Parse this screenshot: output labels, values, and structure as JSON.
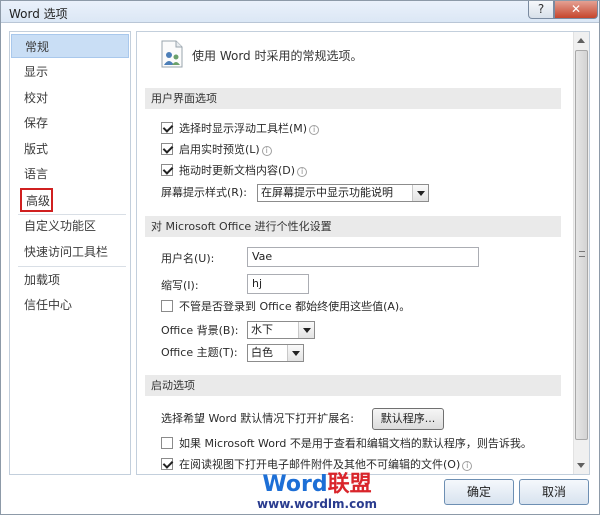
{
  "window": {
    "title": "Word 选项",
    "help_label": "?",
    "close_label": "✕"
  },
  "sidebar": {
    "items": [
      {
        "label": "常规"
      },
      {
        "label": "显示"
      },
      {
        "label": "校对"
      },
      {
        "label": "保存"
      },
      {
        "label": "版式"
      },
      {
        "label": "语言"
      },
      {
        "label": "高级"
      },
      {
        "label": "自定义功能区"
      },
      {
        "label": "快速访问工具栏"
      },
      {
        "label": "加载项"
      },
      {
        "label": "信任中心"
      }
    ],
    "selected": "常规",
    "highlighted": "高级",
    "highlight_color": "#d02020"
  },
  "main": {
    "header_text": "使用 Word 时采用的常规选项。",
    "sections": {
      "ui": {
        "title": "用户界面选项",
        "opt1": "选择时显示浮动工具栏(M)",
        "opt2": "启用实时预览(L)",
        "opt3": "拖动时更新文档内容(D)",
        "tooltip_label": "屏幕提示样式(R):",
        "tooltip_value": "在屏幕提示中显示功能说明"
      },
      "personalize": {
        "title": "对 Microsoft Office 进行个性化设置",
        "username_label": "用户名(U):",
        "username_value": "Vae",
        "initials_label": "缩写(I):",
        "initials_value": "hj",
        "always_use": "不管是否登录到 Office 都始终使用这些值(A)。",
        "background_label": "Office 背景(B):",
        "background_value": "水下",
        "theme_label": "Office 主题(T):",
        "theme_value": "白色"
      },
      "startup": {
        "title": "启动选项",
        "ext_label": "选择希望 Word 默认情况下打开扩展名:",
        "default_programs": "默认程序...",
        "notify": "如果 Microsoft Word 不是用于查看和编辑文档的默认程序，则告诉我。",
        "reading_view": "在阅读视图下打开电子邮件附件及其他不可编辑的文件(O)"
      }
    }
  },
  "footer": {
    "ok": "确定",
    "cancel": "取消",
    "watermark_word": "Word",
    "watermark_cn": "联盟",
    "watermark_url": "www.wordlm.com"
  },
  "icons": {
    "help": "help-icon",
    "close": "close-icon",
    "header": "general-options-icon",
    "info": "info-icon",
    "dropdown": "chevron-down-icon"
  }
}
